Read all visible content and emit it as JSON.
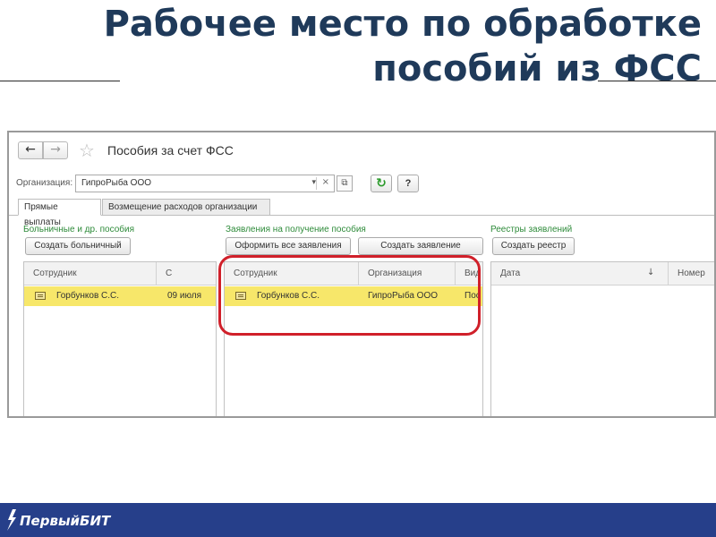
{
  "slide": {
    "title_line1": "Рабочее место по обработке",
    "title_line2": "пособий из ФСС",
    "brand": "ПервыйБИТ"
  },
  "window": {
    "title": "Пособия за счет ФСС",
    "nav_back": "←",
    "nav_forward": "→",
    "star": "☆"
  },
  "organization": {
    "label": "Организация:",
    "value": "ГипроРыба ООО",
    "dropdown_icon": "▾",
    "clear_icon": "×",
    "open_icon": "⧉",
    "refresh_icon": "↻",
    "help_label": "?"
  },
  "tabs": [
    {
      "label": "Прямые выплаты",
      "active": true
    },
    {
      "label": "Возмещение расходов организации",
      "active": false
    }
  ],
  "sections": {
    "sick_leave": {
      "label": "Больничные и др. пособия",
      "create_button": "Создать больничный",
      "columns": [
        "Сотрудник",
        "С"
      ],
      "rows": [
        {
          "employee": "Горбунков С.С.",
          "from": "09 июля"
        }
      ]
    },
    "applications": {
      "label": "Заявления на получение пособия",
      "process_all_button": "Оформить все заявления",
      "create_button": "Создать заявление",
      "columns": [
        "Сотрудник",
        "Организация",
        "Вид"
      ],
      "rows": [
        {
          "employee": "Горбунков С.С.",
          "organization": "ГипроРыба ООО",
          "kind": "Пос"
        }
      ]
    },
    "registries": {
      "label": "Реестры заявлений",
      "create_button": "Создать реестр",
      "columns": [
        "Дата",
        "Номер"
      ],
      "sort_icon": "↓",
      "rows": []
    }
  },
  "colors": {
    "title": "#1f3a5a",
    "section_label": "#2e8b3a",
    "selected_row": "#f7e76a",
    "highlight_ring": "#d0202a",
    "footer": "#263f8a"
  }
}
